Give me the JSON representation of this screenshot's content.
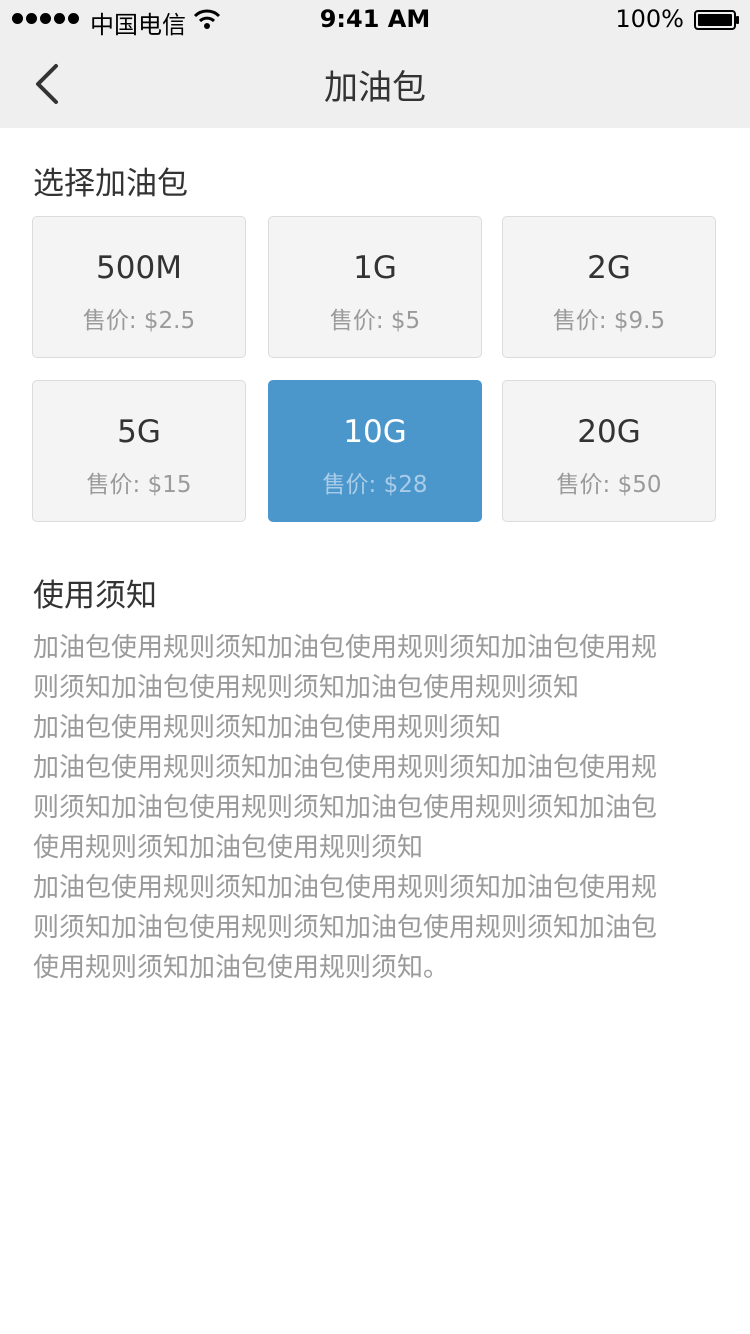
{
  "status_bar": {
    "carrier": "中国电信",
    "time": "9:41 AM",
    "battery": "100%"
  },
  "nav": {
    "title": "加油包",
    "back_icon": "chevron-left-icon"
  },
  "packages_section": {
    "title": "选择加油包",
    "items": [
      {
        "size": "500M",
        "price": "售价: $2.5",
        "selected": false
      },
      {
        "size": "1G",
        "price": "售价: $5",
        "selected": false
      },
      {
        "size": "2G",
        "price": "售价: $9.5",
        "selected": false
      },
      {
        "size": "5G",
        "price": "售价: $15",
        "selected": false
      },
      {
        "size": "10G",
        "price": "售价: $28",
        "selected": true
      },
      {
        "size": "20G",
        "price": "售价: $50",
        "selected": false
      }
    ]
  },
  "notice_section": {
    "title": "使用须知",
    "lines": [
      "加油包使用规则须知加油包使用规则须知加油包使用规",
      "则须知加油包使用规则须知加油包使用规则须知",
      "加油包使用规则须知加油包使用规则须知",
      "加油包使用规则须知加油包使用规则须知加油包使用规",
      "则须知加油包使用规则须知加油包使用规则须知加油包",
      "使用规则须知加油包使用规则须知",
      "加油包使用规则须知加油包使用规则须知加油包使用规",
      "则须知加油包使用规则须知加油包使用规则须知加油包",
      "使用规则须知加油包使用规则须知。"
    ]
  },
  "colors": {
    "accent": "#4b97cc",
    "nav_bg": "#efefef",
    "card_bg": "#f4f4f4"
  }
}
